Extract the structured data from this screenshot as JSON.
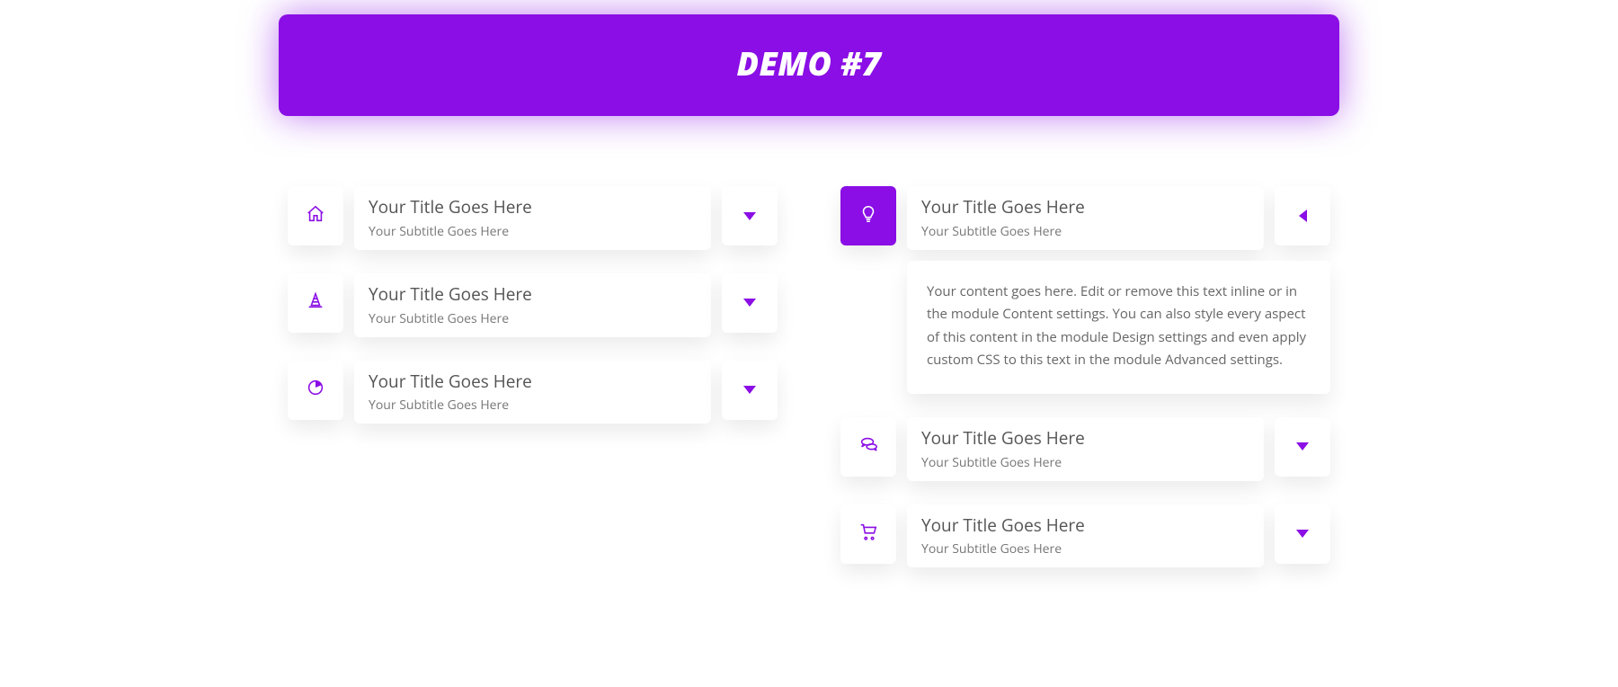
{
  "banner": {
    "title": "DEMO #7"
  },
  "left": [
    {
      "icon": "home-icon",
      "title": "Your Title Goes Here",
      "subtitle": "Your Subtitle Goes Here",
      "open": false
    },
    {
      "icon": "cone-icon",
      "title": "Your Title Goes Here",
      "subtitle": "Your Subtitle Goes Here",
      "open": false
    },
    {
      "icon": "pie-chart-icon",
      "title": "Your Title Goes Here",
      "subtitle": "Your Subtitle Goes Here",
      "open": false
    }
  ],
  "right": [
    {
      "icon": "lightbulb-icon",
      "title": "Your Title Goes Here",
      "subtitle": "Your Subtitle Goes Here",
      "open": true,
      "content": "Your content goes here. Edit or remove this text inline or in the module Content settings. You can also style every aspect of this content in the module Design settings and even apply custom CSS to this text in the module Advanced settings."
    },
    {
      "icon": "chat-icon",
      "title": "Your Title Goes Here",
      "subtitle": "Your Subtitle Goes Here",
      "open": false
    },
    {
      "icon": "cart-icon",
      "title": "Your Title Goes Here",
      "subtitle": "Your Subtitle Goes Here",
      "open": false
    }
  ],
  "colors": {
    "accent": "#8a0ee5"
  }
}
